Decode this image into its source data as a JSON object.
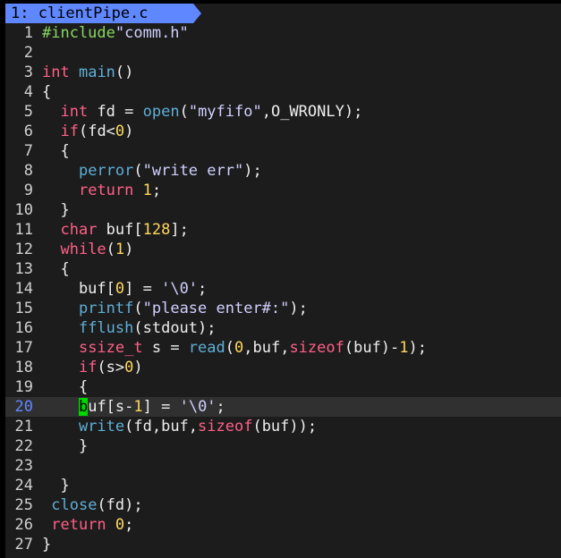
{
  "tab": {
    "label": "1: clientPipe.c"
  },
  "colors": {
    "background": "#1c1c1c",
    "tab": "#5f87ff",
    "keyword": "#ff5f87",
    "function": "#5fafd7",
    "number": "#ffd75f",
    "string": "#d0d0ff",
    "preprocessor": "#87d75f",
    "cursor": "#00d700"
  },
  "cursor": {
    "line": 20,
    "column": 5
  },
  "lines": [
    {
      "n": "1",
      "tokens": [
        {
          "t": "#include",
          "c": "pre"
        },
        {
          "t": "\"comm.h\"",
          "c": "str"
        }
      ]
    },
    {
      "n": "2",
      "tokens": []
    },
    {
      "n": "3",
      "tokens": [
        {
          "t": "int",
          "c": "kw"
        },
        {
          "t": " ",
          "c": "txt"
        },
        {
          "t": "main",
          "c": "fn"
        },
        {
          "t": "()",
          "c": "txt"
        }
      ]
    },
    {
      "n": "4",
      "tokens": [
        {
          "t": "{",
          "c": "txt"
        }
      ]
    },
    {
      "n": "5",
      "tokens": [
        {
          "t": "  ",
          "c": "txt"
        },
        {
          "t": "int",
          "c": "kw"
        },
        {
          "t": " fd = ",
          "c": "txt"
        },
        {
          "t": "open",
          "c": "fn"
        },
        {
          "t": "(",
          "c": "txt"
        },
        {
          "t": "\"myfifo\"",
          "c": "str"
        },
        {
          "t": ",O_WRONLY);",
          "c": "txt"
        }
      ]
    },
    {
      "n": "6",
      "tokens": [
        {
          "t": "  ",
          "c": "txt"
        },
        {
          "t": "if",
          "c": "kw"
        },
        {
          "t": "(fd<",
          "c": "txt"
        },
        {
          "t": "0",
          "c": "num"
        },
        {
          "t": ")",
          "c": "txt"
        }
      ]
    },
    {
      "n": "7",
      "tokens": [
        {
          "t": "  {",
          "c": "txt"
        }
      ]
    },
    {
      "n": "8",
      "tokens": [
        {
          "t": "    ",
          "c": "txt"
        },
        {
          "t": "perror",
          "c": "fn"
        },
        {
          "t": "(",
          "c": "txt"
        },
        {
          "t": "\"write err\"",
          "c": "str"
        },
        {
          "t": ");",
          "c": "txt"
        }
      ]
    },
    {
      "n": "9",
      "tokens": [
        {
          "t": "    ",
          "c": "txt"
        },
        {
          "t": "return",
          "c": "kw"
        },
        {
          "t": " ",
          "c": "txt"
        },
        {
          "t": "1",
          "c": "num"
        },
        {
          "t": ";",
          "c": "txt"
        }
      ]
    },
    {
      "n": "10",
      "tokens": [
        {
          "t": "  }",
          "c": "txt"
        }
      ]
    },
    {
      "n": "11",
      "tokens": [
        {
          "t": "  ",
          "c": "txt"
        },
        {
          "t": "char",
          "c": "kw"
        },
        {
          "t": " buf[",
          "c": "txt"
        },
        {
          "t": "128",
          "c": "num"
        },
        {
          "t": "];",
          "c": "txt"
        }
      ]
    },
    {
      "n": "12",
      "tokens": [
        {
          "t": "  ",
          "c": "txt"
        },
        {
          "t": "while",
          "c": "kw"
        },
        {
          "t": "(",
          "c": "txt"
        },
        {
          "t": "1",
          "c": "num"
        },
        {
          "t": ")",
          "c": "txt"
        }
      ]
    },
    {
      "n": "13",
      "tokens": [
        {
          "t": "  {",
          "c": "txt"
        }
      ]
    },
    {
      "n": "14",
      "tokens": [
        {
          "t": "    buf[",
          "c": "txt"
        },
        {
          "t": "0",
          "c": "num"
        },
        {
          "t": "] = ",
          "c": "txt"
        },
        {
          "t": "'\\0'",
          "c": "str"
        },
        {
          "t": ";",
          "c": "txt"
        }
      ]
    },
    {
      "n": "15",
      "tokens": [
        {
          "t": "    ",
          "c": "txt"
        },
        {
          "t": "printf",
          "c": "fn"
        },
        {
          "t": "(",
          "c": "txt"
        },
        {
          "t": "\"please enter#:\"",
          "c": "str"
        },
        {
          "t": ");",
          "c": "txt"
        }
      ]
    },
    {
      "n": "16",
      "tokens": [
        {
          "t": "    ",
          "c": "txt"
        },
        {
          "t": "fflush",
          "c": "fn"
        },
        {
          "t": "(stdout);",
          "c": "txt"
        }
      ]
    },
    {
      "n": "17",
      "tokens": [
        {
          "t": "    ",
          "c": "txt"
        },
        {
          "t": "ssize_t",
          "c": "kw"
        },
        {
          "t": " s = ",
          "c": "txt"
        },
        {
          "t": "read",
          "c": "fn"
        },
        {
          "t": "(",
          "c": "txt"
        },
        {
          "t": "0",
          "c": "num"
        },
        {
          "t": ",buf,",
          "c": "txt"
        },
        {
          "t": "sizeof",
          "c": "kw"
        },
        {
          "t": "(buf)-",
          "c": "txt"
        },
        {
          "t": "1",
          "c": "num"
        },
        {
          "t": ");",
          "c": "txt"
        }
      ]
    },
    {
      "n": "18",
      "tokens": [
        {
          "t": "    ",
          "c": "txt"
        },
        {
          "t": "if",
          "c": "kw"
        },
        {
          "t": "(s>",
          "c": "txt"
        },
        {
          "t": "0",
          "c": "num"
        },
        {
          "t": ")",
          "c": "txt"
        }
      ]
    },
    {
      "n": "19",
      "tokens": [
        {
          "t": "    {",
          "c": "txt"
        }
      ]
    },
    {
      "n": "20",
      "tokens": [
        {
          "t": "    ",
          "c": "txt"
        },
        {
          "t": "b",
          "c": "cursor"
        },
        {
          "t": "uf[s-",
          "c": "txt"
        },
        {
          "t": "1",
          "c": "num"
        },
        {
          "t": "] = ",
          "c": "txt"
        },
        {
          "t": "'\\0'",
          "c": "str"
        },
        {
          "t": ";",
          "c": "txt"
        }
      ]
    },
    {
      "n": "21",
      "tokens": [
        {
          "t": "    ",
          "c": "txt"
        },
        {
          "t": "write",
          "c": "fn"
        },
        {
          "t": "(fd,buf,",
          "c": "txt"
        },
        {
          "t": "sizeof",
          "c": "kw"
        },
        {
          "t": "(buf));",
          "c": "txt"
        }
      ]
    },
    {
      "n": "22",
      "tokens": [
        {
          "t": "    }",
          "c": "txt"
        }
      ]
    },
    {
      "n": "23",
      "tokens": []
    },
    {
      "n": "24",
      "tokens": [
        {
          "t": "  }",
          "c": "txt"
        }
      ]
    },
    {
      "n": "25",
      "tokens": [
        {
          "t": " ",
          "c": "txt"
        },
        {
          "t": "close",
          "c": "fn"
        },
        {
          "t": "(fd);",
          "c": "txt"
        }
      ]
    },
    {
      "n": "26",
      "tokens": [
        {
          "t": " ",
          "c": "txt"
        },
        {
          "t": "return",
          "c": "kw"
        },
        {
          "t": " ",
          "c": "txt"
        },
        {
          "t": "0",
          "c": "num"
        },
        {
          "t": ";",
          "c": "txt"
        }
      ]
    },
    {
      "n": "27",
      "tokens": [
        {
          "t": "}",
          "c": "txt"
        }
      ]
    }
  ]
}
